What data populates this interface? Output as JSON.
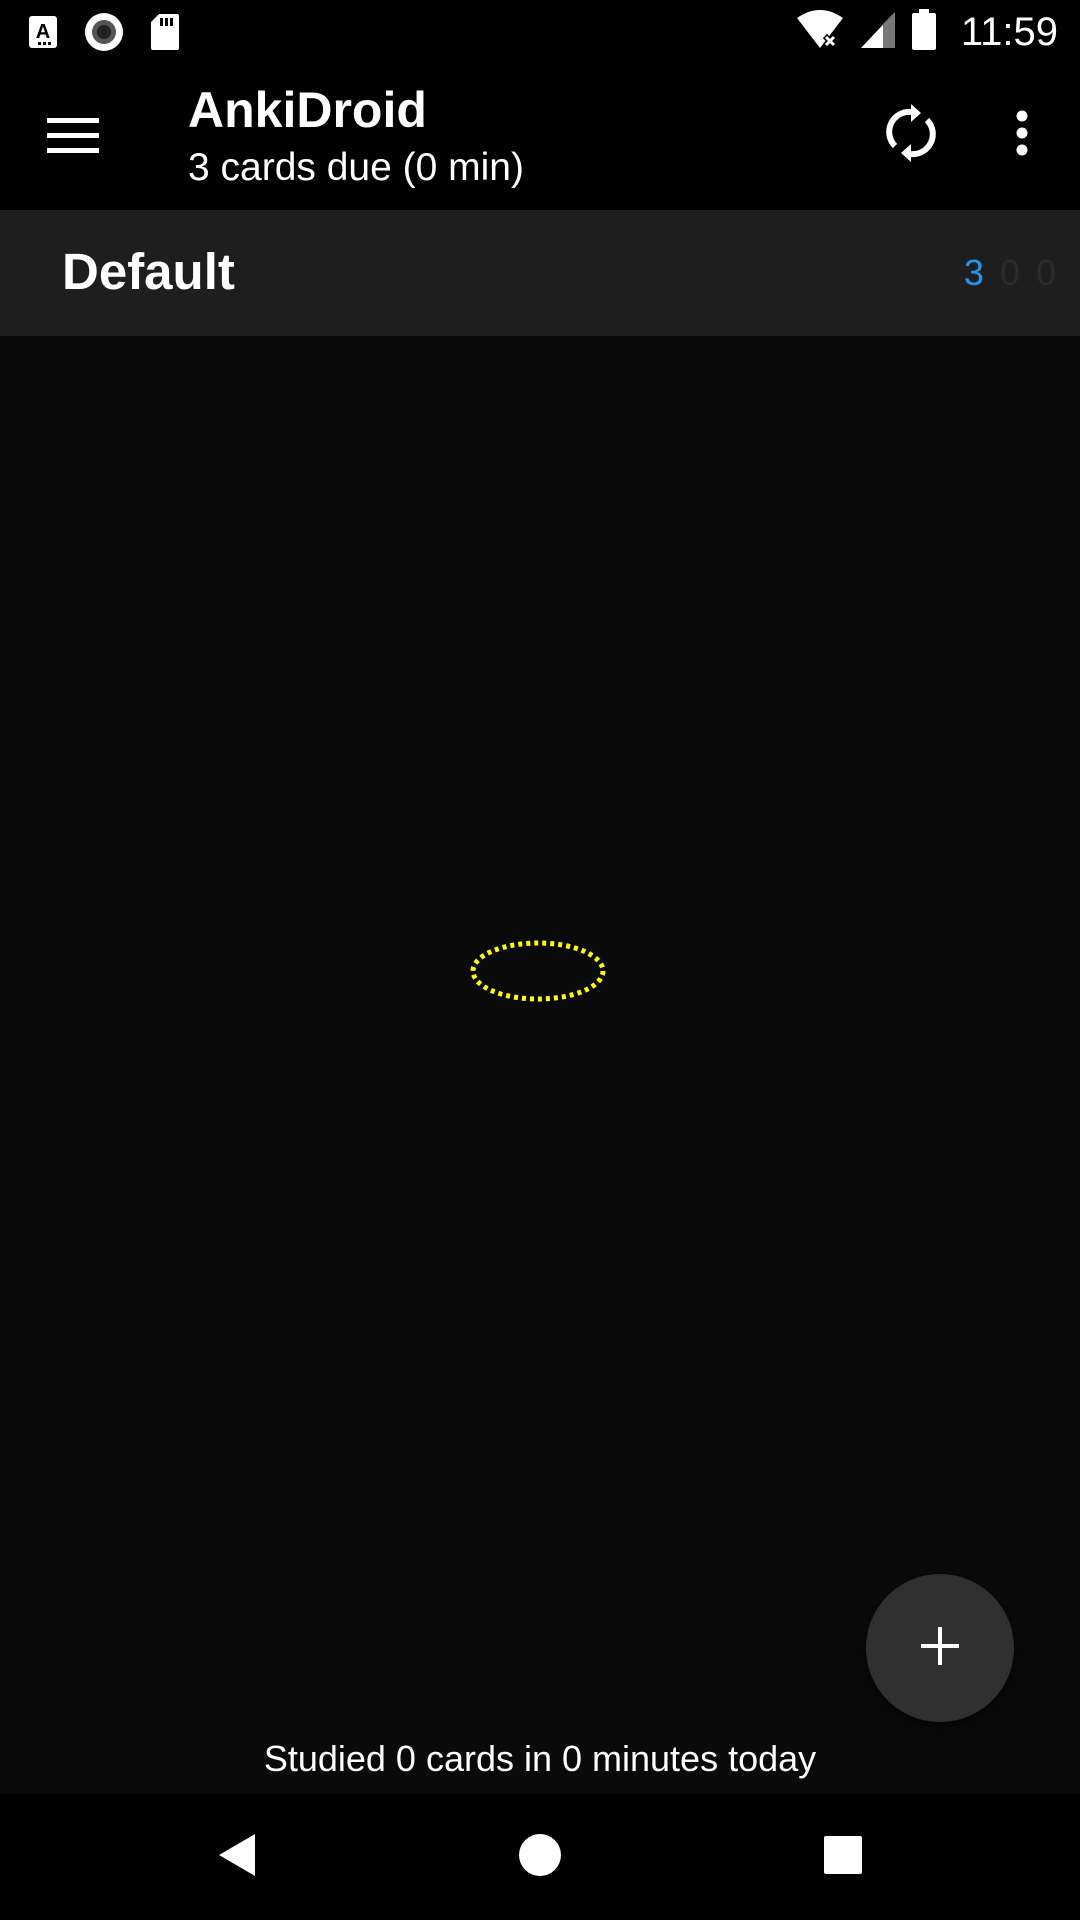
{
  "status_bar": {
    "time": "11:59",
    "left_icons": [
      "font-a-icon",
      "record-icon",
      "sd-card-icon"
    ],
    "right_icons": [
      "wifi-off-icon",
      "signal-icon",
      "battery-icon"
    ]
  },
  "app_bar": {
    "title": "AnkiDroid",
    "subtitle": "3 cards due (0 min)",
    "icons": [
      "menu-icon",
      "sync-icon",
      "overflow-menu-icon"
    ]
  },
  "decks": [
    {
      "name": "Default",
      "new": "3",
      "learn": "0",
      "review": "0"
    }
  ],
  "footer": {
    "studied": "Studied 0 cards in 0 minutes today"
  },
  "fab": {
    "icon": "plus-icon"
  },
  "nav_bar": {
    "icons": [
      "back-icon",
      "home-icon",
      "recents-icon"
    ]
  },
  "colors": {
    "new_count": "#2196f3",
    "deck_row_bg": "#1e1e1e",
    "content_bg": "#0a0a0a",
    "fab_bg": "#303030",
    "tap_marker": "#ffff00"
  }
}
